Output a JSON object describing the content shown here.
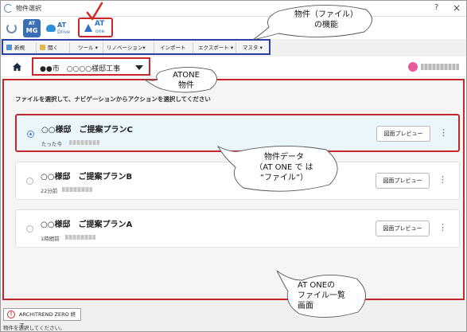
{
  "window": {
    "title": "物件選択",
    "help": "?",
    "close": "×"
  },
  "apps": {
    "mg_top": "AT",
    "mg_bottom": "MG",
    "drive_top": "AT",
    "drive_bottom": "Drive",
    "one_top": "AT",
    "one_bottom": "one"
  },
  "toolbar": {
    "items": [
      "新規",
      "開く",
      "ツール ▾",
      "リノベーション▾",
      "インポート",
      "エクスポート ▾",
      "マスタ ▾"
    ]
  },
  "breadcrumb": {
    "project": "●●市　○○○○様邸工事"
  },
  "main": {
    "instruction": "ファイルを選択して、ナビゲーションからアクションを選択してください"
  },
  "files": [
    {
      "name": "○○様邸　ご提案プランC",
      "time": "たった今",
      "selected": true
    },
    {
      "name": "○○様邸　ご提案プランB",
      "time": "22分前",
      "selected": false
    },
    {
      "name": "○○様邸　ご提案プランA",
      "time": "1時間前",
      "selected": false
    }
  ],
  "preview_label": "図面プレビュー",
  "more_label": "⋮",
  "statusbar": {
    "end_button": "ARCHITREND ZERO 終了",
    "warn_glyph": "!",
    "message": "物件を選択してください。"
  },
  "callouts": {
    "file_features": [
      "物件（ファイル）",
      "の機能"
    ],
    "atone_project": [
      "ATONE",
      "物件"
    ],
    "project_data": [
      "物件データ",
      "（AT ONE で は",
      "“ファイル”）"
    ],
    "file_list": [
      "AT ONEの",
      "ファイル一覧",
      "画面"
    ]
  },
  "colors": {
    "highlight": "#c8262a",
    "toolbar_frame": "#2a3fa8",
    "accent": "#2f6fd0",
    "selected_bg": "#eaf5fc"
  },
  "icons": [
    "refresh-icon",
    "home-icon",
    "user-avatar-icon",
    "warning-icon",
    "more-vert-icon",
    "checkmark-icon"
  ]
}
